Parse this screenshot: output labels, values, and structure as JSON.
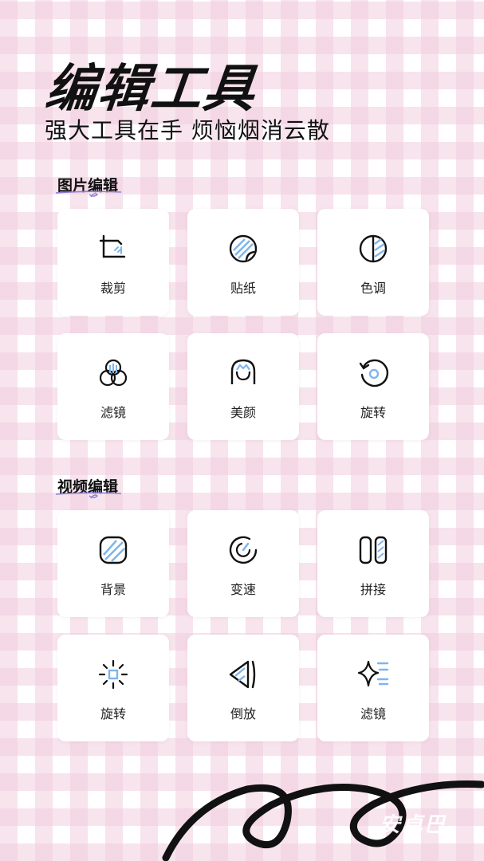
{
  "hero": {
    "title": "编辑工具",
    "subtitle": "强大工具在手 烦恼烟消云散"
  },
  "sections": [
    {
      "title": "图片编辑",
      "items": [
        {
          "label": "裁剪",
          "icon": "crop-icon"
        },
        {
          "label": "贴纸",
          "icon": "sticker-icon"
        },
        {
          "label": "色调",
          "icon": "tone-icon"
        },
        {
          "label": "滤镜",
          "icon": "filter-icon"
        },
        {
          "label": "美颜",
          "icon": "beauty-icon"
        },
        {
          "label": "旋转",
          "icon": "rotate-icon"
        }
      ]
    },
    {
      "title": "视频编辑",
      "items": [
        {
          "label": "背景",
          "icon": "background-icon"
        },
        {
          "label": "变速",
          "icon": "speed-icon"
        },
        {
          "label": "拼接",
          "icon": "splice-icon"
        },
        {
          "label": "旋转",
          "icon": "sun-rotate-icon"
        },
        {
          "label": "倒放",
          "icon": "reverse-icon"
        },
        {
          "label": "滤镜",
          "icon": "sparkle-filter-icon"
        }
      ]
    }
  ],
  "watermark": "安卓巴",
  "colors": {
    "accent_blue": "#7fb6ec",
    "stroke": "#111111",
    "checker_pink": "#f1cdde"
  }
}
